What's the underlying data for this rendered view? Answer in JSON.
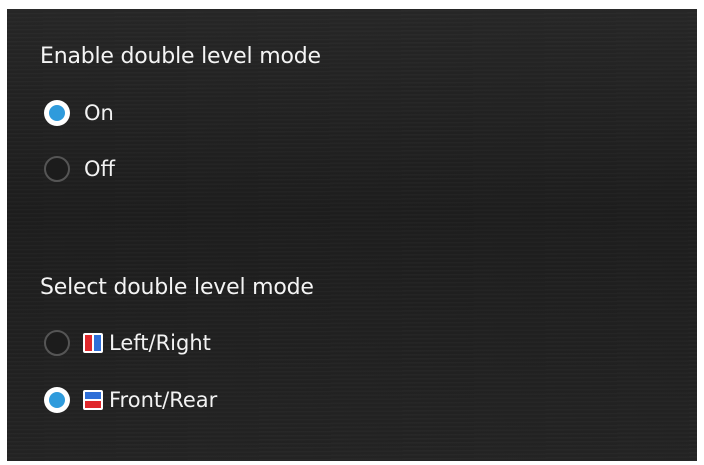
{
  "enable_section": {
    "heading": "Enable double level mode",
    "options": [
      {
        "label": "On",
        "selected": true
      },
      {
        "label": "Off",
        "selected": false
      }
    ]
  },
  "select_section": {
    "heading": "Select double level mode",
    "options": [
      {
        "label": "Left/Right",
        "icon": "left-right-split-icon",
        "selected": false
      },
      {
        "label": "Front/Rear",
        "icon": "front-rear-split-icon",
        "selected": true
      }
    ]
  },
  "colors": {
    "accent": "#2f9bdc",
    "zone_primary": "#e0282c",
    "zone_secondary": "#2f6fd8",
    "background": "#212121"
  }
}
